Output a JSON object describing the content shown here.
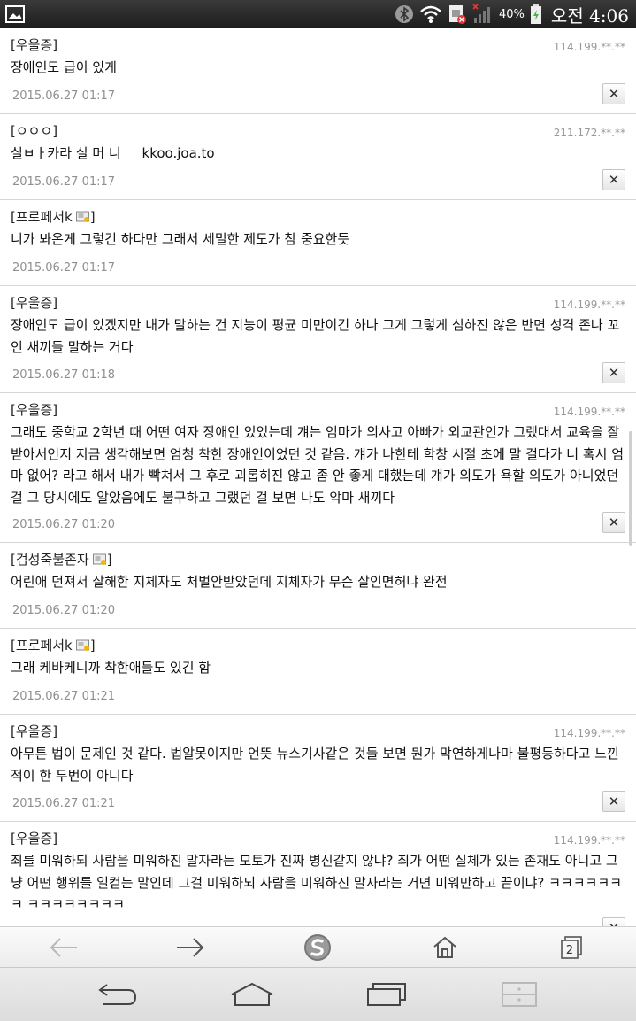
{
  "status_bar": {
    "battery_percent": "40%",
    "time": "오전 4:06",
    "icons": [
      "gallery-icon",
      "bluetooth-icon",
      "wifi-icon",
      "sim-error-icon",
      "signal-icon",
      "battery-icon"
    ]
  },
  "comments": [
    {
      "author": "[우울증]",
      "ip": "114.199.**.**",
      "text": "장애인도 급이 있게",
      "date": "2015.06.27 01:17",
      "deletable": true
    },
    {
      "author": "[ㅇㅇㅇ]",
      "ip": "211.172.**.**",
      "text": "실ㅂㅏ카라 실 머 니     kkoo.joa.to",
      "date": "2015.06.27 01:17",
      "deletable": true
    },
    {
      "author": "[프로페서k",
      "ip": "",
      "text": "니가 봐온게 그렇긴 하다만 그래서 세밀한 제도가 참 중요한듯",
      "date": "2015.06.27 01:17",
      "deletable": false,
      "author_suffix": "]"
    },
    {
      "author": "[우울증]",
      "ip": "114.199.**.**",
      "text": "장애인도 급이 있겠지만 내가 말하는 건 지능이 평균 미만이긴 하나 그게 그렇게 심하진 않은 반면 성격 존나 꼬인 새끼들 말하는 거다",
      "date": "2015.06.27 01:18",
      "deletable": true
    },
    {
      "author": "[우울증]",
      "ip": "114.199.**.**",
      "text": "그래도 중학교 2학년 때 어떤 여자 장애인 있었는데 걔는 엄마가 의사고 아빠가 외교관인가 그랬대서 교육을 잘 받아서인지 지금 생각해보면 엄청 착한 장애인이었던 것 같음. 걔가 나한테 학창 시절 초에 말 걸다가 너 혹시 엄마 없어? 라고 해서 내가 빡쳐서 그 후로 괴롭히진 않고 좀 안 좋게 대했는데 걔가 의도가 욕할 의도가 아니었던 걸 그 당시에도 알았음에도 불구하고 그랬던 걸 보면 나도 악마 새끼다",
      "date": "2015.06.27 01:20",
      "deletable": true
    },
    {
      "author": "[검성죽불존자",
      "ip": "",
      "text": "어린애 던져서 살해한 지체자도 처벌안받았던데 지체자가 무슨 살인면허냐 완전",
      "date": "2015.06.27 01:20",
      "deletable": false,
      "author_suffix": "]"
    },
    {
      "author": "[프로페서k",
      "ip": "",
      "text": "그래 케바케니까 착한애들도 있긴 함",
      "date": "2015.06.27 01:21",
      "deletable": false,
      "author_suffix": "]"
    },
    {
      "author": "[우울증]",
      "ip": "114.199.**.**",
      "text": "아무튼 법이 문제인 것 같다. 법알못이지만 언뜻 뉴스기사같은 것들 보면 뭔가 막연하게나마 불평등하다고 느낀 적이 한 두번이 아니다",
      "date": "2015.06.27 01:21",
      "deletable": true
    },
    {
      "author": "[우울증]",
      "ip": "114.199.**.**",
      "text": "죄를 미워하되 사람을 미워하진 말자라는 모토가 진짜 병신같지 않냐? 죄가 어떤 실체가 있는 존재도 아니고 그냥 어떤 행위를 일컫는 말인데 그걸 미워하되 사람을 미워하진 말자라는 거면 미워만하고 끝이냐? ㅋㅋㅋㅋㅋㅋㅋ ㅋㅋㅋㅋㅋㅋㅋㅋ",
      "date": "",
      "deletable": true
    }
  ],
  "close_label": "✕",
  "browser_toolbar": {
    "tab_count": "2"
  }
}
